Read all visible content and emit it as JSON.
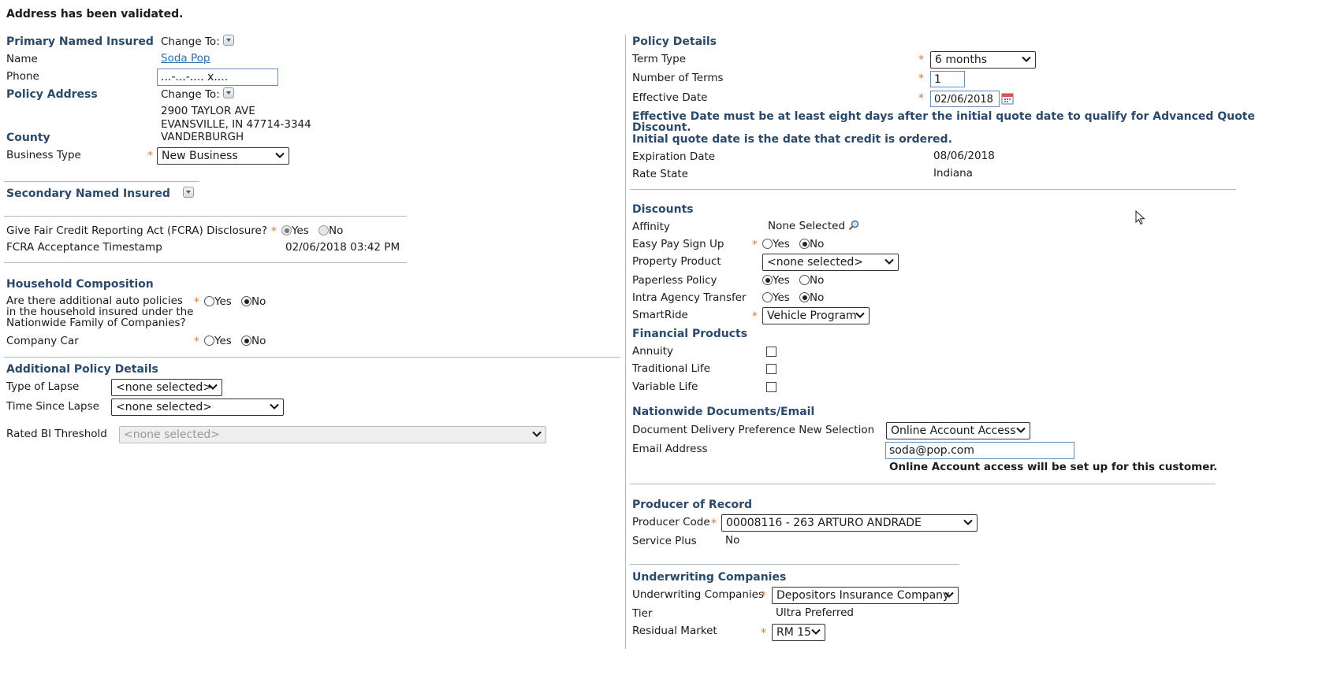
{
  "banner": "Address has been validated.",
  "left": {
    "primary_named_insured": {
      "title": "Primary Named Insured",
      "change_to": "Change To:",
      "name_label": "Name",
      "name_value": "Soda Pop",
      "phone_label": "Phone",
      "phone_value": "...-...-.... x....",
      "policy_address_label": "Policy Address",
      "address_change_to": "Change To:",
      "address_line1": "2900 TAYLOR AVE",
      "address_line2": "EVANSVILLE, IN 47714-3344",
      "county_label": "County",
      "county_value": "VANDERBURGH",
      "business_type_label": "Business Type",
      "business_type_value": "New Business"
    },
    "secondary_named_insured": {
      "title": "Secondary Named Insured"
    },
    "fcra": {
      "question": "Give Fair Credit Reporting Act (FCRA) Disclosure?",
      "yes": "Yes",
      "no": "No",
      "selected": "Yes",
      "timestamp_label": "FCRA Acceptance Timestamp",
      "timestamp_value": "02/06/2018 03:42 PM"
    },
    "household": {
      "title": "Household Composition",
      "question_line1": "Are there additional auto policies",
      "question_line2": "in the household insured under the",
      "question_line3": "Nationwide Family of Companies?",
      "company_car_label": "Company Car",
      "yes": "Yes",
      "no": "No"
    },
    "additional_policy": {
      "title": "Additional Policy Details",
      "type_of_lapse_label": "Type of Lapse",
      "type_of_lapse_value": "<none selected>",
      "time_since_lapse_label": "Time Since Lapse",
      "time_since_lapse_value": "<none selected>",
      "rated_bi_label": "Rated BI Threshold",
      "rated_bi_value": "<none selected>"
    }
  },
  "right": {
    "policy_details": {
      "title": "Policy Details",
      "term_type_label": "Term Type",
      "term_type_value": "6 months",
      "num_terms_label": "Number of Terms",
      "num_terms_value": "1",
      "effective_date_label": "Effective Date",
      "effective_date_value": "02/06/2018",
      "notice_line1": "Effective Date must be at least eight days after the initial quote date to qualify for Advanced Quote",
      "notice_line2": "Discount.",
      "notice_line3": "Initial quote date is the date that credit is ordered.",
      "expiration_label": "Expiration Date",
      "expiration_value": "08/06/2018",
      "rate_state_label": "Rate State",
      "rate_state_value": "Indiana"
    },
    "discounts": {
      "title": "Discounts",
      "affinity_label": "Affinity",
      "affinity_value": "None Selected",
      "easy_pay_label": "Easy Pay Sign Up",
      "property_label": "Property Product",
      "property_value": "<none selected>",
      "paperless_label": "Paperless Policy",
      "intra_label": "Intra Agency Transfer",
      "smartride_label": "SmartRide",
      "smartride_value": "Vehicle Program",
      "yes": "Yes",
      "no": "No"
    },
    "financial": {
      "title": "Financial Products",
      "annuity": "Annuity",
      "traditional_life": "Traditional Life",
      "variable_life": "Variable Life"
    },
    "documents": {
      "title": "Nationwide Documents/Email",
      "delivery_label": "Document Delivery Preference New Selection",
      "delivery_value": "Online Account Access",
      "email_label": "Email Address",
      "email_value": "soda@pop.com",
      "notice": "Online Account access will be set up for this customer."
    },
    "producer": {
      "title": "Producer of Record",
      "code_label": "Producer Code",
      "code_value": "00008116 - 263 ARTURO ANDRADE",
      "service_plus_label": "Service Plus",
      "service_plus_value": "No"
    },
    "underwriting": {
      "title": "Underwriting Companies",
      "companies_label": "Underwriting Companies",
      "companies_value": "Depositors Insurance Company",
      "tier_label": "Tier",
      "tier_value": "Ultra Preferred",
      "residual_label": "Residual Market",
      "residual_value": "RM 15"
    }
  }
}
